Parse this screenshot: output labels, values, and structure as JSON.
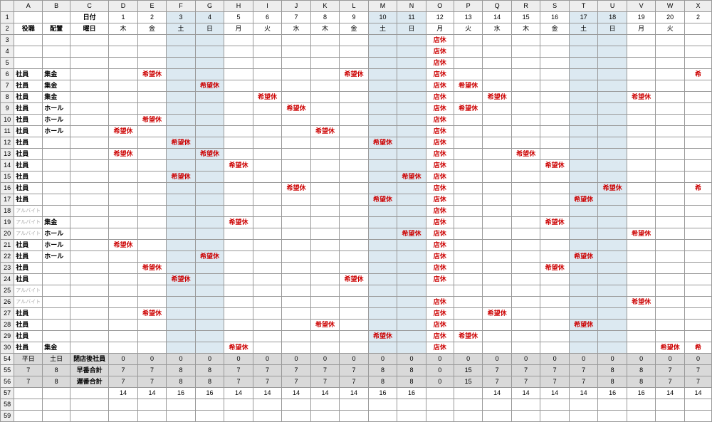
{
  "columns": [
    "",
    "A",
    "B",
    "C",
    "D",
    "E",
    "F",
    "G",
    "H",
    "I",
    "J",
    "K",
    "L",
    "M",
    "N",
    "O",
    "P",
    "Q",
    "R",
    "S",
    "T",
    "U",
    "V",
    "W",
    "X"
  ],
  "headers": {
    "row1_label_C": "日付",
    "row1_days": [
      "1",
      "2",
      "3",
      "4",
      "5",
      "6",
      "7",
      "8",
      "9",
      "10",
      "11",
      "12",
      "13",
      "14",
      "15",
      "16",
      "17",
      "18",
      "19",
      "20",
      "2"
    ],
    "row2_A": "役職",
    "row2_B": "配置",
    "row2_C": "曜日",
    "row2_dow": [
      "木",
      "金",
      "土",
      "日",
      "月",
      "火",
      "水",
      "木",
      "金",
      "土",
      "日",
      "月",
      "火",
      "水",
      "木",
      "金",
      "土",
      "日",
      "月",
      "火",
      ""
    ],
    "weekend_idx": [
      2,
      3,
      9,
      10,
      16,
      17
    ]
  },
  "legend": {
    "tenkyu": "店休",
    "kibou": "希望休"
  },
  "body_rows": [
    {
      "n": 3,
      "a": "",
      "b": "",
      "c": "",
      "cells": {
        "11": "店休"
      }
    },
    {
      "n": 4,
      "a": "",
      "b": "",
      "c": "",
      "cells": {
        "11": "店休"
      }
    },
    {
      "n": 5,
      "a": "",
      "b": "",
      "c": "",
      "cells": {
        "11": "店休"
      }
    },
    {
      "n": 6,
      "a": "社員",
      "b": "集金",
      "c": "",
      "cells": {
        "1": "希望休",
        "8": "希望休",
        "11": "店休",
        "20": "希"
      }
    },
    {
      "n": 7,
      "a": "社員",
      "b": "集金",
      "c": "",
      "cells": {
        "3": "希望休",
        "11": "店休",
        "12": "希望休"
      }
    },
    {
      "n": 8,
      "a": "社員",
      "b": "集金",
      "c": "",
      "cells": {
        "5": "希望休",
        "11": "店休",
        "13": "希望休",
        "18": "希望休"
      }
    },
    {
      "n": 9,
      "a": "社員",
      "b": "ホール",
      "c": "",
      "cells": {
        "6": "希望休",
        "11": "店休",
        "12": "希望休"
      }
    },
    {
      "n": 10,
      "a": "社員",
      "b": "ホール",
      "c": "",
      "cells": {
        "1": "希望休",
        "11": "店休"
      }
    },
    {
      "n": 11,
      "a": "社員",
      "b": "ホール",
      "c": "",
      "cells": {
        "0": "希望休",
        "7": "希望休",
        "11": "店休"
      }
    },
    {
      "n": 12,
      "a": "社員",
      "b": "",
      "bf": true,
      "c": "",
      "cells": {
        "2": "希望休",
        "9": "希望休",
        "11": "店休"
      }
    },
    {
      "n": 13,
      "a": "社員",
      "b": "",
      "bf": true,
      "c": "",
      "cells": {
        "0": "希望休",
        "3": "希望休",
        "11": "店休",
        "14": "希望休"
      }
    },
    {
      "n": 14,
      "a": "社員",
      "b": "",
      "bf": true,
      "c": "",
      "cells": {
        "4": "希望休",
        "11": "店休",
        "15": "希望休"
      }
    },
    {
      "n": 15,
      "a": "社員",
      "b": "",
      "bf": true,
      "c": "",
      "cells": {
        "2": "希望休",
        "10": "希望休",
        "11": "店休"
      }
    },
    {
      "n": 16,
      "a": "社員",
      "b": "",
      "bf": true,
      "c": "",
      "cells": {
        "6": "希望休",
        "11": "店休",
        "17": "希望休",
        "20": "希"
      }
    },
    {
      "n": 17,
      "a": "社員",
      "b": "",
      "bf": true,
      "c": "",
      "cells": {
        "9": "希望休",
        "11": "店休",
        "16": "希望休"
      }
    },
    {
      "n": 18,
      "a": "アルバイト",
      "af": true,
      "b": "",
      "bf": true,
      "c": "",
      "cells": {
        "11": "店休"
      }
    },
    {
      "n": 19,
      "a": "アルバイト",
      "af": true,
      "b": "集金",
      "c": "",
      "cells": {
        "4": "希望休",
        "11": "店休",
        "15": "希望休"
      }
    },
    {
      "n": 20,
      "a": "アルバイト",
      "af": true,
      "b": "ホール",
      "c": "",
      "cells": {
        "10": "希望休",
        "11": "店休",
        "18": "希望休"
      }
    },
    {
      "n": 21,
      "a": "社員",
      "b": "ホール",
      "c": "",
      "cells": {
        "0": "希望休",
        "11": "店休"
      }
    },
    {
      "n": 22,
      "a": "社員",
      "b": "ホール",
      "c": "",
      "cells": {
        "3": "希望休",
        "11": "店休",
        "16": "希望休"
      }
    },
    {
      "n": 23,
      "a": "社員",
      "b": "",
      "bf": true,
      "c": "",
      "cells": {
        "1": "希望休",
        "11": "店休",
        "15": "希望休"
      }
    },
    {
      "n": 24,
      "a": "社員",
      "b": "",
      "bf": true,
      "c": "",
      "cells": {
        "2": "希望休",
        "8": "希望休",
        "11": "店休"
      }
    },
    {
      "n": 25,
      "a": "アルバイト",
      "af": true,
      "b": "",
      "bf": true,
      "c": "",
      "cells": {}
    },
    {
      "n": 26,
      "a": "アルバイト",
      "af": true,
      "b": "",
      "bf": true,
      "c": "",
      "cells": {
        "11": "店休",
        "18": "希望休"
      }
    },
    {
      "n": 27,
      "a": "社員",
      "b": "",
      "bf": true,
      "c": "",
      "cells": {
        "1": "希望休",
        "11": "店休",
        "13": "希望休"
      }
    },
    {
      "n": 28,
      "a": "社員",
      "b": "",
      "bf": true,
      "c": "",
      "cells": {
        "7": "希望休",
        "11": "店休",
        "16": "希望休"
      }
    },
    {
      "n": 29,
      "a": "社員",
      "b": "",
      "bf": true,
      "c": "",
      "cells": {
        "9": "希望休",
        "11": "店休",
        "12": "希望休"
      }
    },
    {
      "n": 30,
      "a": "社員",
      "b": "集金",
      "c": "",
      "cells": {
        "4": "希望休",
        "11": "店休",
        "19": "希望休",
        "20": "希"
      }
    }
  ],
  "footer": {
    "r54": {
      "a": "平日",
      "b": "土日",
      "c": "閉店後社員",
      "vals": [
        "0",
        "0",
        "0",
        "0",
        "0",
        "0",
        "0",
        "0",
        "0",
        "0",
        "0",
        "0",
        "0",
        "0",
        "0",
        "0",
        "0",
        "0",
        "0",
        "0",
        "0"
      ]
    },
    "r55": {
      "a": "7",
      "b": "8",
      "c": "早番合計",
      "vals": [
        "7",
        "7",
        "8",
        "8",
        "7",
        "7",
        "7",
        "7",
        "7",
        "8",
        "8",
        "0",
        "15",
        "7",
        "7",
        "7",
        "7",
        "8",
        "8",
        "7",
        "7"
      ]
    },
    "r56": {
      "a": "7",
      "b": "8",
      "c": "遅番合計",
      "vals": [
        "7",
        "7",
        "8",
        "8",
        "7",
        "7",
        "7",
        "7",
        "7",
        "8",
        "8",
        "0",
        "15",
        "7",
        "7",
        "7",
        "7",
        "8",
        "8",
        "7",
        "7"
      ]
    },
    "r57": {
      "a": "",
      "b": "",
      "c": "",
      "vals": [
        "14",
        "14",
        "16",
        "16",
        "14",
        "14",
        "14",
        "14",
        "14",
        "16",
        "16",
        "",
        "",
        "14",
        "14",
        "14",
        "14",
        "16",
        "16",
        "14",
        "14"
      ]
    }
  }
}
